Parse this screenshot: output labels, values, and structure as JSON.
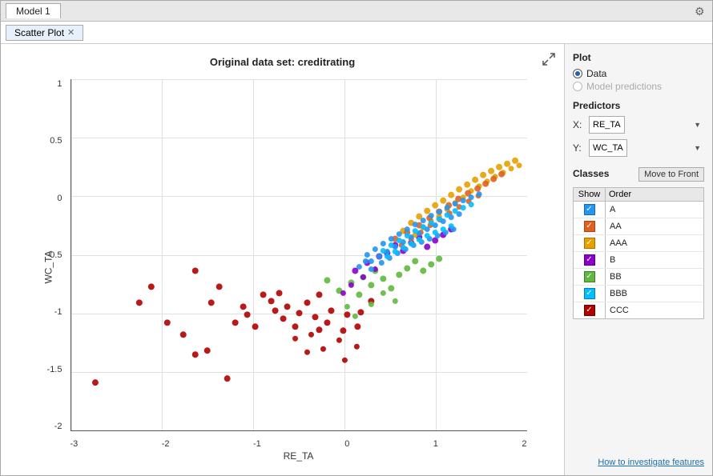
{
  "window": {
    "title_tab": "Model 1",
    "settings_icon": "⚙",
    "scatter_tab": "Scatter Plot",
    "expand_icon": "⤢"
  },
  "chart": {
    "title": "Original data set: creditrating",
    "y_axis_title": "WC_TA",
    "x_axis_title": "RE_TA",
    "y_labels": [
      "1",
      "0.5",
      "0",
      "-0.5",
      "-1",
      "-1.5",
      "-2"
    ],
    "x_labels": [
      "-3",
      "-2",
      "-1",
      "0",
      "1",
      "2"
    ]
  },
  "panel": {
    "plot_label": "Plot",
    "data_label": "Data",
    "model_predictions_label": "Model predictions",
    "predictors_label": "Predictors",
    "x_label": "X:",
    "y_label": "Y:",
    "x_value": "RE_TA",
    "y_value": "WC_TA",
    "classes_label": "Classes",
    "move_to_front_label": "Move to Front",
    "col_show": "Show",
    "col_order": "Order",
    "classes": [
      {
        "name": "A",
        "color": "#2196F3",
        "checked": true
      },
      {
        "name": "AA",
        "color": "#E06020",
        "checked": true
      },
      {
        "name": "AAA",
        "color": "#E8A000",
        "checked": true
      },
      {
        "name": "B",
        "color": "#8B00CC",
        "checked": true
      },
      {
        "name": "BB",
        "color": "#60B840",
        "checked": true
      },
      {
        "name": "BBB",
        "color": "#00BFFF",
        "checked": true
      },
      {
        "name": "CCC",
        "color": "#B00000",
        "checked": true
      }
    ],
    "how_to_link": "How to investigate features"
  }
}
